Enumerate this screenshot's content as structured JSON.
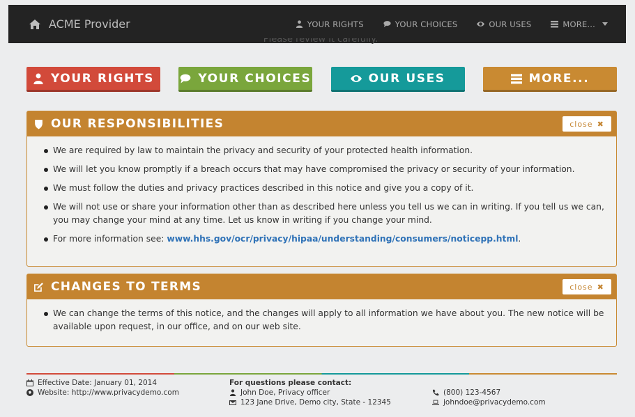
{
  "nav": {
    "brand": "ACME Provider",
    "links": [
      {
        "label": "YOUR RIGHTS",
        "icon": "user-icon"
      },
      {
        "label": "YOUR CHOICES",
        "icon": "comments-icon"
      },
      {
        "label": "OUR USES",
        "icon": "eye-icon"
      },
      {
        "label": "MORE...",
        "icon": "list-icon"
      }
    ]
  },
  "intro_clipped": "Please review it carefully.",
  "buttons": [
    {
      "label": "YOUR RIGHTS",
      "color": "#d24a3a",
      "icon": "user-icon"
    },
    {
      "label": "YOUR CHOICES",
      "color": "#7aa63c",
      "icon": "comments-icon"
    },
    {
      "label": "OUR USES",
      "color": "#159a9a",
      "icon": "eye-icon"
    },
    {
      "label": "MORE...",
      "color": "#c98a32",
      "icon": "list-icon"
    }
  ],
  "responsibilities": {
    "title": "OUR RESPONSIBILITIES",
    "close_label": "close",
    "items": [
      "We are required by law to maintain the privacy and security of your protected health information.",
      "We will let you know promptly if a breach occurs that may have compromised the privacy or security of your information.",
      "We must follow the duties and privacy practices described in this notice and give you a copy of it.",
      "We will not use or share your information other than as described here unless you tell us we can in writing. If you tell us we can, you may change your mind at any time. Let us know in writing if you change your mind."
    ],
    "more_info_prefix": "For more information see: ",
    "more_info_link": "www.hhs.gov/ocr/privacy/hipaa/understanding/consumers/noticepp.html",
    "more_info_suffix": "."
  },
  "changes": {
    "title": "CHANGES TO TERMS",
    "close_label": "close",
    "items": [
      "We can change the terms of this notice, and the changes will apply to all information we have about you. The new notice will be available upon request, in our office, and on our web site."
    ]
  },
  "footer": {
    "effective_date": "Effective Date: January 01, 2014",
    "website": "Website: http://www.privacydemo.com",
    "contact_heading": "For questions please contact:",
    "contact_name": "John Doe, Privacy officer",
    "contact_address": "123 Jane Drive, Demo city, State - 12345",
    "phone": "(800) 123-4567",
    "email": "johndoe@privacydemo.com"
  },
  "colors": {
    "navbar": "#232323",
    "panel_header": "#c48430",
    "link": "#2f72b7"
  }
}
